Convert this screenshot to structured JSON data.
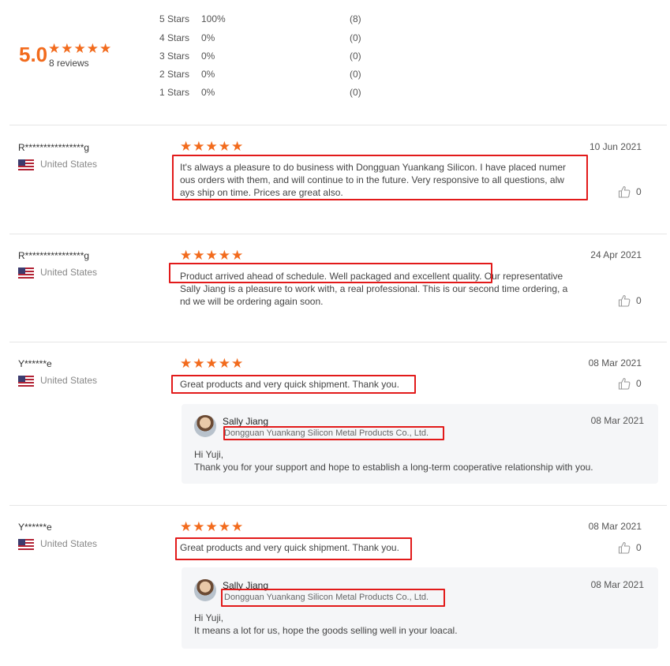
{
  "summary": {
    "score": "5.0",
    "stars": "★★★★★",
    "count_label": "8 reviews"
  },
  "distribution": [
    {
      "label": "5  Stars",
      "percent": "100%",
      "count": "(8)"
    },
    {
      "label": "4  Stars",
      "percent": "0%",
      "count": "(0)"
    },
    {
      "label": "3  Stars",
      "percent": "0%",
      "count": "(0)"
    },
    {
      "label": "2  Stars",
      "percent": "0%",
      "count": "(0)"
    },
    {
      "label": "1  Stars",
      "percent": "0%",
      "count": "(0)"
    }
  ],
  "reviews": [
    {
      "reviewer": "R****************g",
      "country": "United States",
      "stars": "★★★★★",
      "date": "10 Jun 2021",
      "text_lines": [
        "It's always a pleasure to do business with Dongguan Yuankang Silicon. I have placed numer",
        "ous orders with them, and will continue to in the future. Very responsive to all questions, alw",
        "ays ship on time. Prices are great also."
      ],
      "likes": "0"
    },
    {
      "reviewer": "R****************g",
      "country": "United States",
      "stars": "★★★★★",
      "date": "24 Apr 2021",
      "text_lines": [
        "Product arrived ahead of schedule. Well packaged and excellent quality. Our representative",
        "Sally Jiang is a pleasure to work with, a real professional. This is our second time ordering, a",
        "nd we will be ordering again soon."
      ],
      "likes": "0"
    },
    {
      "reviewer": "Y******e",
      "country": "United States",
      "stars": "★★★★★",
      "date": "08 Mar 2021",
      "text_lines": [
        "Great products and very quick shipment. Thank you."
      ],
      "likes": "0",
      "reply": {
        "name": "Sally Jiang",
        "company": "Dongguan Yuankang Silicon Metal Products Co., Ltd.",
        "date": "08 Mar 2021",
        "lines": [
          "Hi Yuji,",
          "Thank you for your support and  hope to establish a long-term cooperative relationship with you."
        ]
      }
    },
    {
      "reviewer": "Y******e",
      "country": "United States",
      "stars": "★★★★★",
      "date": "08 Mar 2021",
      "text_lines": [
        "Great products and very quick shipment. Thank you."
      ],
      "likes": "0",
      "reply": {
        "name": "Sally Jiang",
        "company": "Dongguan Yuankang Silicon Metal Products Co., Ltd.",
        "date": "08 Mar 2021",
        "lines": [
          "Hi Yuji,",
          "It means a lot for us, hope the goods selling well in your loacal."
        ]
      }
    }
  ],
  "colors": {
    "accent_orange": "#f26b1d",
    "highlight_red": "#e21a1a"
  },
  "icons": {
    "star": "star-icon",
    "flag": "us-flag-icon",
    "like": "thumbs-up-icon",
    "avatar": "avatar"
  }
}
